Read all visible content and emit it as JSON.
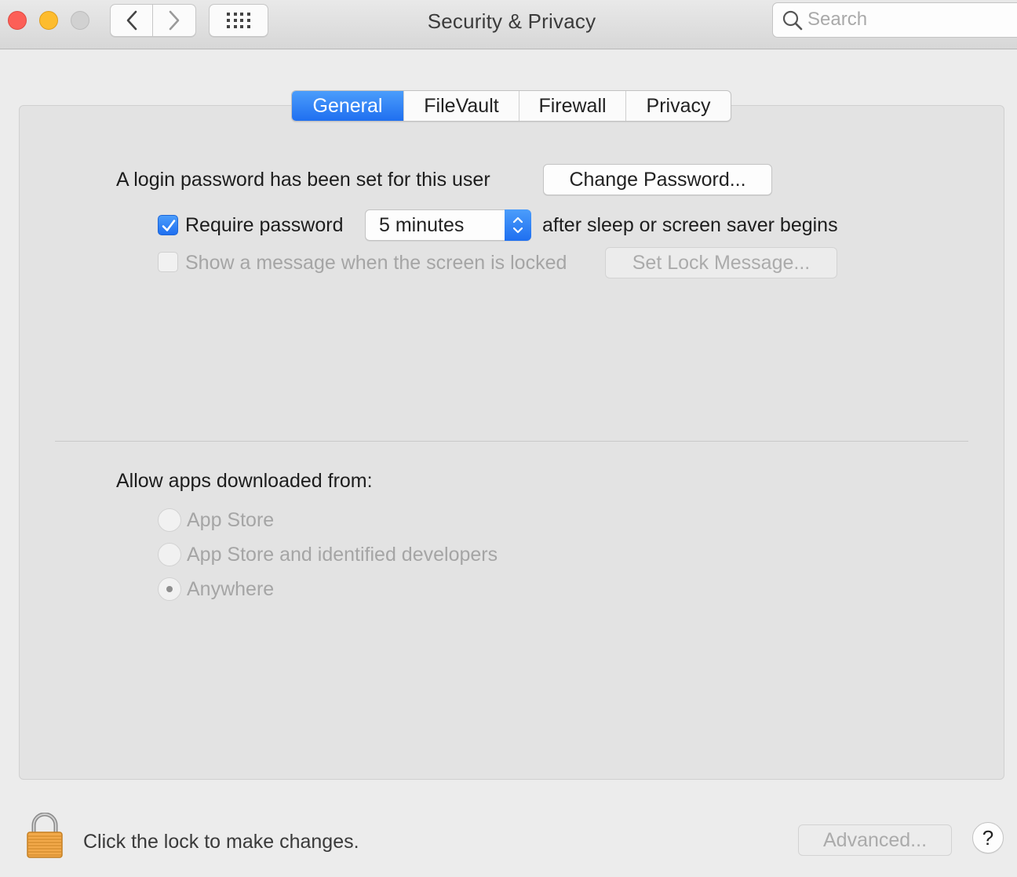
{
  "window": {
    "title": "Security & Privacy",
    "search_placeholder": "Search"
  },
  "tabs": [
    {
      "label": "General",
      "active": true
    },
    {
      "label": "FileVault",
      "active": false
    },
    {
      "label": "Firewall",
      "active": false
    },
    {
      "label": "Privacy",
      "active": false
    }
  ],
  "general": {
    "login_text": "A login password has been set for this user",
    "change_password_label": "Change Password...",
    "require_password_label": "Require password",
    "require_password_checked": true,
    "require_password_delay": "5 minutes",
    "after_sleep_text": "after sleep or screen saver begins",
    "show_message_label": "Show a message when the screen is locked",
    "show_message_checked": false,
    "set_lock_message_label": "Set Lock Message..."
  },
  "allow_apps": {
    "heading": "Allow apps downloaded from:",
    "options": [
      {
        "label": "App Store",
        "selected": false
      },
      {
        "label": "App Store and identified developers",
        "selected": false
      },
      {
        "label": "Anywhere",
        "selected": true
      }
    ]
  },
  "footer": {
    "lock_text": "Click the lock to make changes.",
    "advanced_label": "Advanced...",
    "help_label": "?"
  },
  "colors": {
    "accent": "#1f6ff0",
    "close": "#fc5f57",
    "minimize": "#fdbc2e",
    "zoom_disabled": "#d1d1d1",
    "lock_body": "#f2a94a"
  },
  "icons": [
    "close-icon",
    "minimize-icon",
    "zoom-icon",
    "chevron-left-icon",
    "chevron-right-icon",
    "grid-icon",
    "search-icon",
    "checkmark-icon",
    "chevron-up-down-icon",
    "lock-icon"
  ]
}
